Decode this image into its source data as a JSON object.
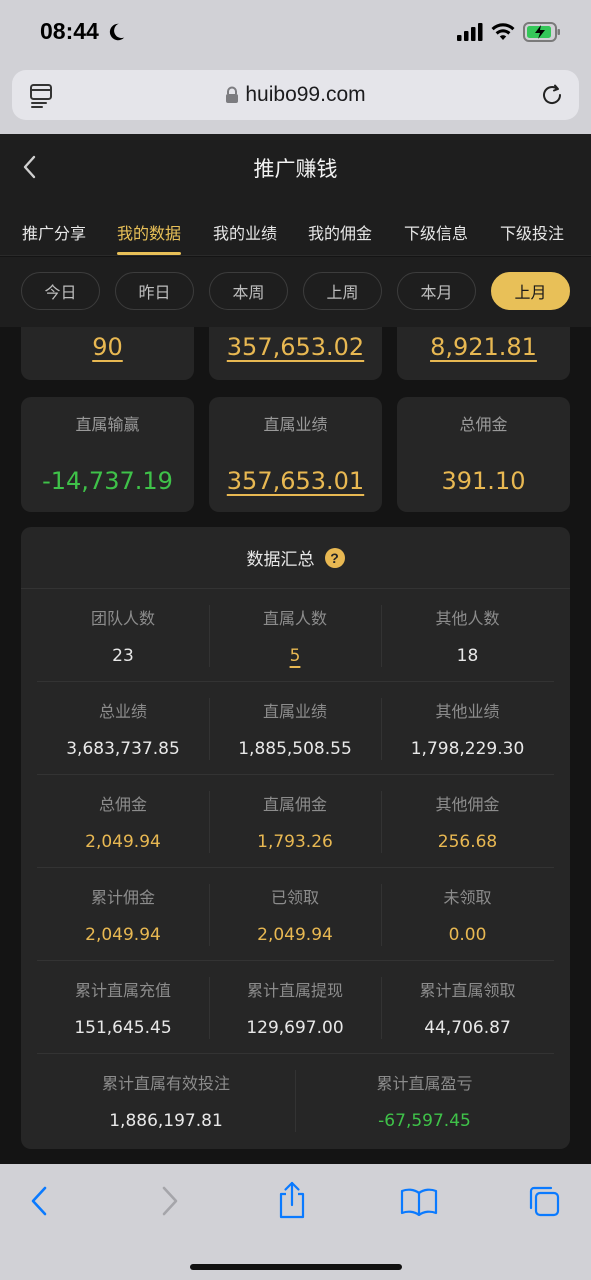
{
  "status_bar": {
    "time": "08:44"
  },
  "browser": {
    "url": "huibo99.com"
  },
  "app": {
    "title": "推广赚钱",
    "tabs": [
      {
        "label": "推广分享",
        "active": false
      },
      {
        "label": "我的数据",
        "active": true
      },
      {
        "label": "我的业绩",
        "active": false
      },
      {
        "label": "我的佣金",
        "active": false
      },
      {
        "label": "下级信息",
        "active": false
      },
      {
        "label": "下级投注",
        "active": false
      }
    ],
    "filters": [
      {
        "label": "今日",
        "active": false
      },
      {
        "label": "昨日",
        "active": false
      },
      {
        "label": "本周",
        "active": false
      },
      {
        "label": "上周",
        "active": false
      },
      {
        "label": "本月",
        "active": false
      },
      {
        "label": "上月",
        "active": true
      }
    ],
    "top_cards_partial": [
      {
        "value": "90"
      },
      {
        "value": "357,653.02"
      },
      {
        "value": "8,921.81"
      }
    ],
    "cards": [
      {
        "label": "直属输赢",
        "value": "-14,737.19"
      },
      {
        "label": "直属业绩",
        "value": "357,653.01"
      },
      {
        "label": "总佣金",
        "value": "391.10"
      }
    ],
    "summary": {
      "title": "数据汇总",
      "help_glyph": "?",
      "rows": [
        [
          {
            "label": "团队人数",
            "value": "23"
          },
          {
            "label": "直属人数",
            "value": "5"
          },
          {
            "label": "其他人数",
            "value": "18"
          }
        ],
        [
          {
            "label": "总业绩",
            "value": "3,683,737.85"
          },
          {
            "label": "直属业绩",
            "value": "1,885,508.55"
          },
          {
            "label": "其他业绩",
            "value": "1,798,229.30"
          }
        ],
        [
          {
            "label": "总佣金",
            "value": "2,049.94"
          },
          {
            "label": "直属佣金",
            "value": "1,793.26"
          },
          {
            "label": "其他佣金",
            "value": "256.68"
          }
        ],
        [
          {
            "label": "累计佣金",
            "value": "2,049.94"
          },
          {
            "label": "已领取",
            "value": "2,049.94"
          },
          {
            "label": "未领取",
            "value": "0.00"
          }
        ],
        [
          {
            "label": "累计直属充值",
            "value": "151,645.45"
          },
          {
            "label": "累计直属提现",
            "value": "129,697.00"
          },
          {
            "label": "累计直属领取",
            "value": "44,706.87"
          }
        ],
        [
          {
            "label": "累计直属有效投注",
            "value": "1,886,197.81"
          },
          {
            "label": "累计直属盈亏",
            "value": "-67,597.45"
          }
        ]
      ]
    }
  },
  "colors": {
    "accent_gold": "#e8b852",
    "positive_green": "#3fc249",
    "background": "#141414",
    "card": "#262626"
  },
  "icons": [
    "moon-icon",
    "signal-icon",
    "wifi-icon",
    "battery-icon",
    "page-menu-icon",
    "lock-icon",
    "reload-icon",
    "back-chevron-icon",
    "help-icon",
    "safari-back-icon",
    "safari-forward-icon",
    "share-icon",
    "bookmarks-icon",
    "tabs-icon"
  ]
}
